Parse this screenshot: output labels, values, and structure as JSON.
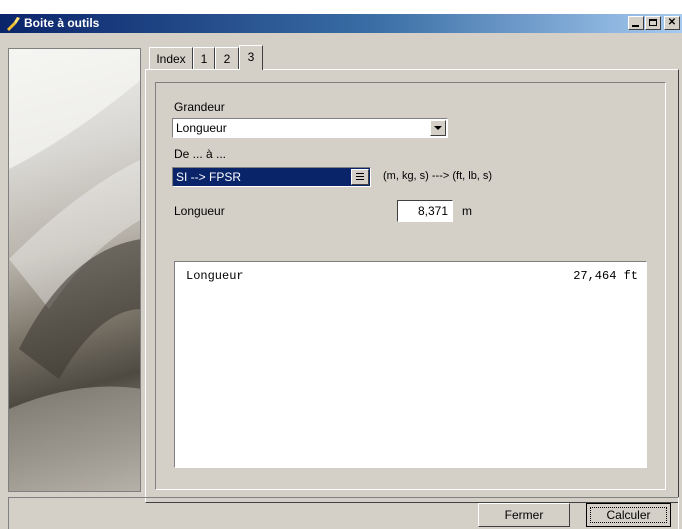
{
  "window": {
    "title": "Boite à outils",
    "icon": "tool-icon"
  },
  "tabs": [
    {
      "label": "Index",
      "active": false
    },
    {
      "label": "1",
      "active": false
    },
    {
      "label": "2",
      "active": false
    },
    {
      "label": "3",
      "active": true
    }
  ],
  "form": {
    "grandeur_label": "Grandeur",
    "grandeur_value": "Longueur",
    "de_a_label": "De ... à ...",
    "de_a_value": "SI --> FPSR",
    "de_a_hint": "(m, kg, s) ---> (ft, lb, s)",
    "quantity_label": "Longueur",
    "quantity_value": "8,371",
    "quantity_unit": "m"
  },
  "results": [
    {
      "name": "Longueur",
      "value": "27,464 ft"
    }
  ],
  "buttons": {
    "close_label": "Fermer",
    "calc_label": "Calculer"
  },
  "colors": {
    "selection": "#0a246a",
    "face": "#d4d0c8"
  }
}
